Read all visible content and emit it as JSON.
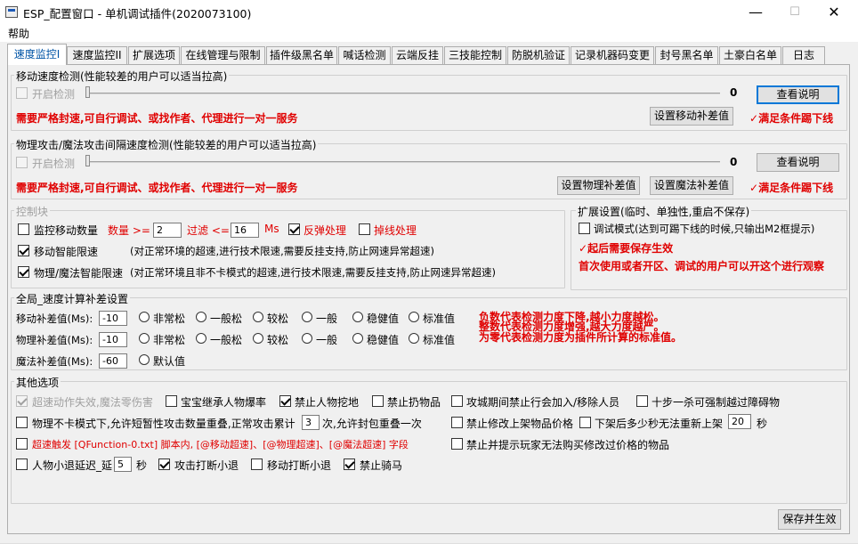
{
  "window": {
    "title": "ESP_配置窗口 - 单机调试插件(2020073100)",
    "min": "—",
    "max": "☐",
    "close": "✕"
  },
  "menu": {
    "help": "帮助"
  },
  "tabs": [
    "速度监控I",
    "速度监控II",
    "扩展选项",
    "在线管理与限制",
    "插件级黑名单",
    "喊话检测",
    "云端反挂",
    "三技能控制",
    "防脱机验证",
    "记录机器码变更",
    "封号黑名单",
    "土豪白名单",
    "日志"
  ],
  "move_group": {
    "title": "移动速度检测(性能较差的用户可以适当拉高)",
    "enable": "开启检测",
    "value": "0",
    "view_btn": "查看说明",
    "note": "需要严格封速,可自行调试、或找作者、代理进行一对一服务",
    "comp_btn": "设置移动补差值",
    "kick": "满足条件踢下线"
  },
  "attack_group": {
    "title": "物理攻击/魔法攻击间隔速度检测(性能较差的用户可以适当拉高)",
    "enable": "开启检测",
    "value": "0",
    "view_btn": "查看说明",
    "note": "需要严格封速,可自行调试、或找作者、代理进行一对一服务",
    "phys_btn": "设置物理补差值",
    "magic_btn": "设置魔法补差值",
    "kick": "满足条件踢下线"
  },
  "control": {
    "title": "控制块",
    "monitor": "监控移动数量",
    "count_lbl": "数量 >=",
    "count": "2",
    "filter_lbl": "过滤 <=",
    "filter": "16",
    "ms": "Ms",
    "rebound": "反弹处理",
    "disconnect": "掉线处理",
    "smart_move": "移动智能限速",
    "smart_move_desc": "(对正常环境的超速,进行技术限速,需要反挂支持,防止网速异常超速)",
    "smart_attack": "物理/魔法智能限速",
    "smart_attack_desc": "(对正常环境且非不卡模式的超速,进行技术限速,需要反挂支持,防止网速异常超速)"
  },
  "ext": {
    "title": "扩展设置(临时、单独性,重启不保存)",
    "debug": "调试模式(达到可踢下线的时候,只输出M2框提示)",
    "save_note": "起后需要保存生效",
    "first_note": "首次使用或者开区、调试的用户可以开这个进行观察"
  },
  "global": {
    "title": "全局_速度计算补差设置",
    "move_lbl": "移动补差值(Ms):",
    "move_val": "-10",
    "phys_lbl": "物理补差值(Ms):",
    "phys_val": "-10",
    "magic_lbl": "魔法补差值(Ms):",
    "magic_val": "-60",
    "levels": [
      "非常松",
      "一般松",
      "较松",
      "一般",
      "稳健值",
      "标准值"
    ],
    "default": "默认值",
    "note1": "负数代表检测力度下降,越小力度越松。",
    "note2": "整数代表检测力度增强,越大力度越严。",
    "note3": "为零代表检测力度为插件所计算的标准值。"
  },
  "other": {
    "title": "其他选项",
    "o1": "超速动作失效,魔法零伤害",
    "o2": "宝宝继承人物爆率",
    "o3": "禁止人物挖地",
    "o4": "禁止扔物品",
    "o5": "攻城期间禁止行会加入/移除人员",
    "o6": "十步一杀可强制越过障碍物",
    "o7a": "物理不卡模式下,允许短暂性攻击数量重叠,正常攻击累计",
    "o7v": "3",
    "o7b": "次,允许封包重叠一次",
    "o8": "禁止修改上架物品价格",
    "o9a": "下架后多少秒无法重新上架",
    "o9v": "20",
    "o9b": "秒",
    "o10": "超速触发 [QFunction-0.txt] 脚本内, [@移动超速]、[@物理超速]、[@魔法超速] 字段",
    "o11": "禁止并提示玩家无法购买修改过价格的物品",
    "o12a": "人物小退延迟_延",
    "o12v": "5",
    "o12b": "秒",
    "o13": "攻击打断小退",
    "o14": "移动打断小退",
    "o15": "禁止骑马"
  },
  "save_btn": "保存并生效",
  "colors": {
    "accent": "#0078d7",
    "warn": "#e00000",
    "tabActive": "#0054a6"
  }
}
